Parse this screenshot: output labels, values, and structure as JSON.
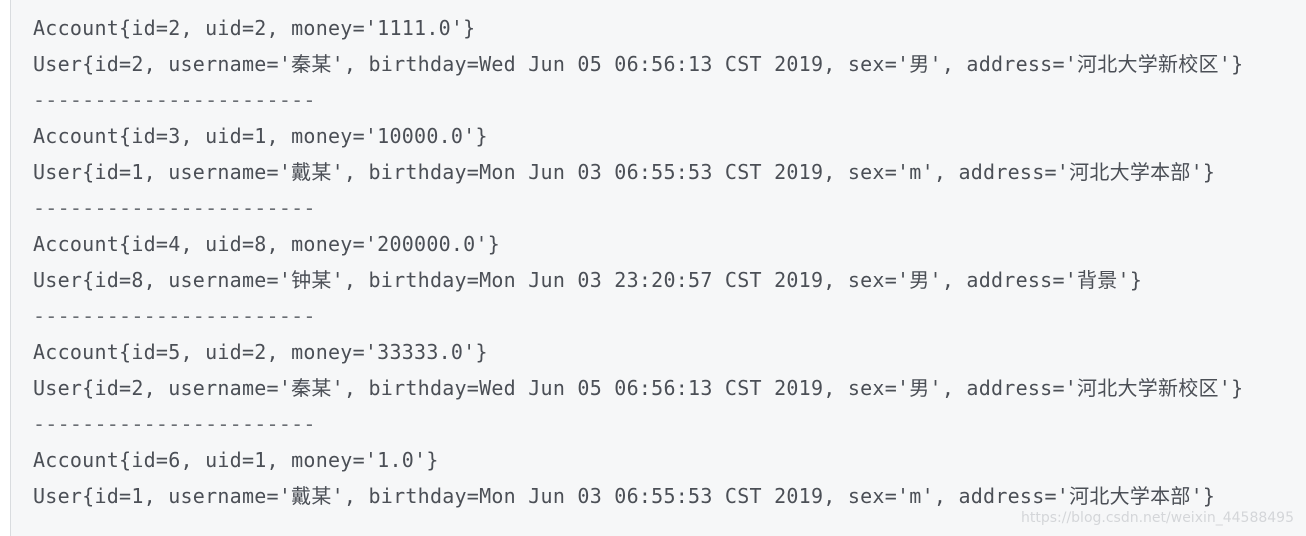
{
  "console": {
    "lines": [
      "Account{id=2, uid=2, money='1111.0'}",
      "User{id=2, username='秦某', birthday=Wed Jun 05 06:56:13 CST 2019, sex='男', address='河北大学新校区'}",
      "-----------------------",
      "Account{id=3, uid=1, money='10000.0'}",
      "User{id=1, username='戴某', birthday=Mon Jun 03 06:55:53 CST 2019, sex='m', address='河北大学本部'}",
      "-----------------------",
      "Account{id=4, uid=8, money='200000.0'}",
      "User{id=8, username='钟某', birthday=Mon Jun 03 23:20:57 CST 2019, sex='男', address='背景'}",
      "-----------------------",
      "Account{id=5, uid=2, money='33333.0'}",
      "User{id=2, username='秦某', birthday=Wed Jun 05 06:56:13 CST 2019, sex='男', address='河北大学新校区'}",
      "-----------------------",
      "Account{id=6, uid=1, money='1.0'}",
      "User{id=1, username='戴某', birthday=Mon Jun 03 06:55:53 CST 2019, sex='m', address='河北大学本部'}"
    ]
  },
  "watermark": "https://blog.csdn.net/weixin_44588495"
}
